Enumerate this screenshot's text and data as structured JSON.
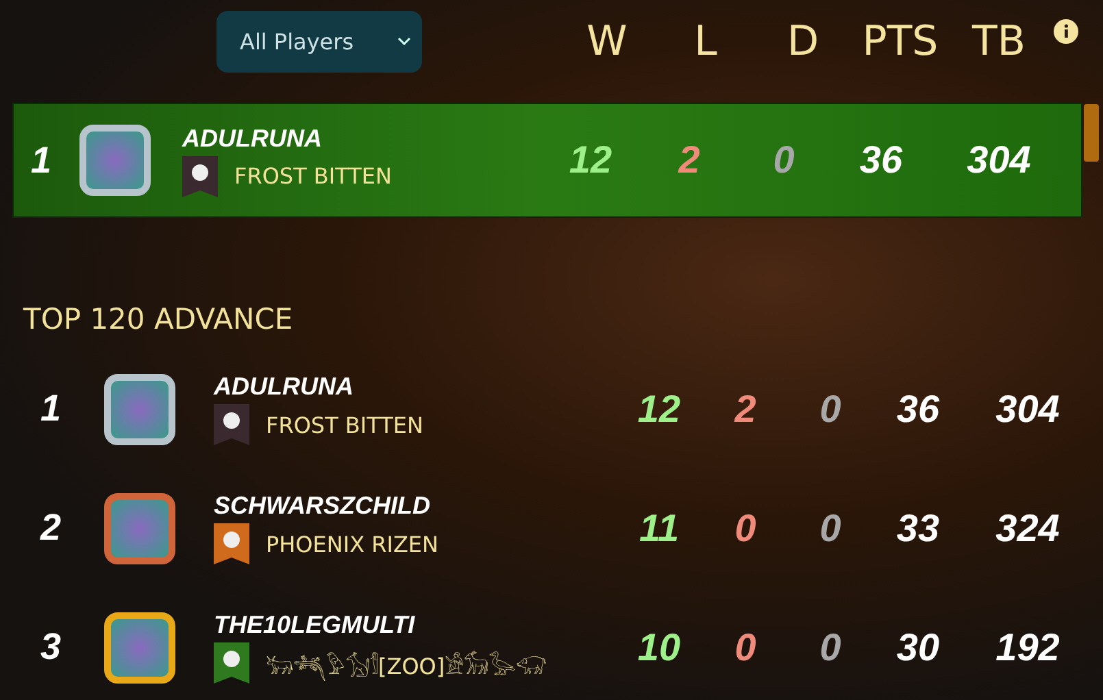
{
  "filter": {
    "value": "All Players"
  },
  "columns": [
    "W",
    "L",
    "D",
    "PTS",
    "TB"
  ],
  "highlight": {
    "rank": "1",
    "name": "ADULRUNA",
    "avatar": {
      "color": "#b8c4cc"
    },
    "guild": {
      "name": "FROST BITTEN",
      "color": "#3a2a30"
    },
    "w": "12",
    "l": "2",
    "d": "0",
    "pts": "36",
    "tb": "304"
  },
  "section_title": "TOP 120 ADVANCE",
  "rows": [
    {
      "rank": "1",
      "name": "ADULRUNA",
      "avatar": {
        "color": "#b8c4cc"
      },
      "guild": {
        "name": "FROST BITTEN",
        "color": "#3a2a30"
      },
      "w": "12",
      "l": "2",
      "d": "0",
      "pts": "36",
      "tb": "304"
    },
    {
      "rank": "2",
      "name": "SCHWARSZCHILD",
      "avatar": {
        "color": "#d0643a"
      },
      "guild": {
        "name": "PHOENIX RIZEN",
        "color": "#d06a1c"
      },
      "w": "11",
      "l": "0",
      "d": "0",
      "pts": "33",
      "tb": "324"
    },
    {
      "rank": "3",
      "name": "THE10LEGMULTI",
      "avatar": {
        "color": "#e8a818"
      },
      "guild": {
        "name": "𓃒𓆈𓅱𓃩𓀾[ZOO]𓀀𓃘𓅭𓃟",
        "color": "#2f7a1e"
      },
      "w": "10",
      "l": "0",
      "d": "0",
      "pts": "30",
      "tb": "192"
    }
  ]
}
